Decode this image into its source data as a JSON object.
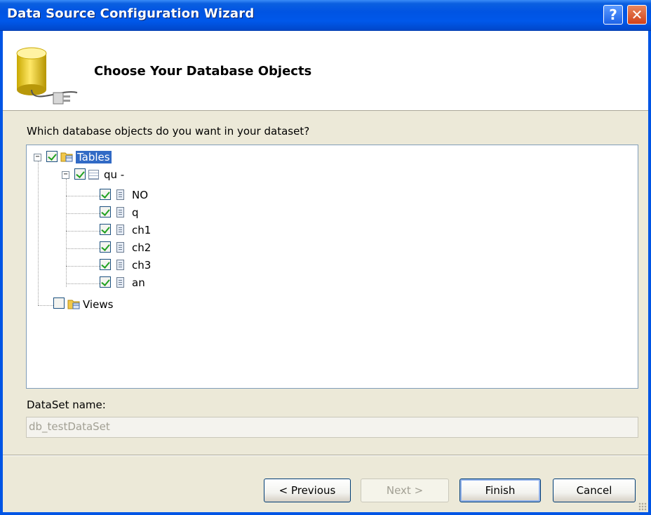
{
  "window": {
    "title": "Data Source Configuration Wizard",
    "help_label": "?",
    "close_label": "✕"
  },
  "header": {
    "title": "Choose Your Database Objects"
  },
  "main": {
    "question": "Which database objects do you want in your dataset?",
    "tree": {
      "tables_label": "Tables",
      "table_name": "qu -",
      "columns": [
        "NO",
        "q",
        "ch1",
        "ch2",
        "ch3",
        "an"
      ],
      "views_label": "Views",
      "tables_checked": true,
      "views_checked": false
    },
    "dataset_label": "DataSet name:",
    "dataset_value": "db_testDataSet"
  },
  "buttons": {
    "previous": "< Previous",
    "next": "Next >",
    "finish": "Finish",
    "cancel": "Cancel"
  },
  "colors": {
    "titlebar": "#0054e3",
    "selection": "#316ac5",
    "check": "#21a121"
  }
}
